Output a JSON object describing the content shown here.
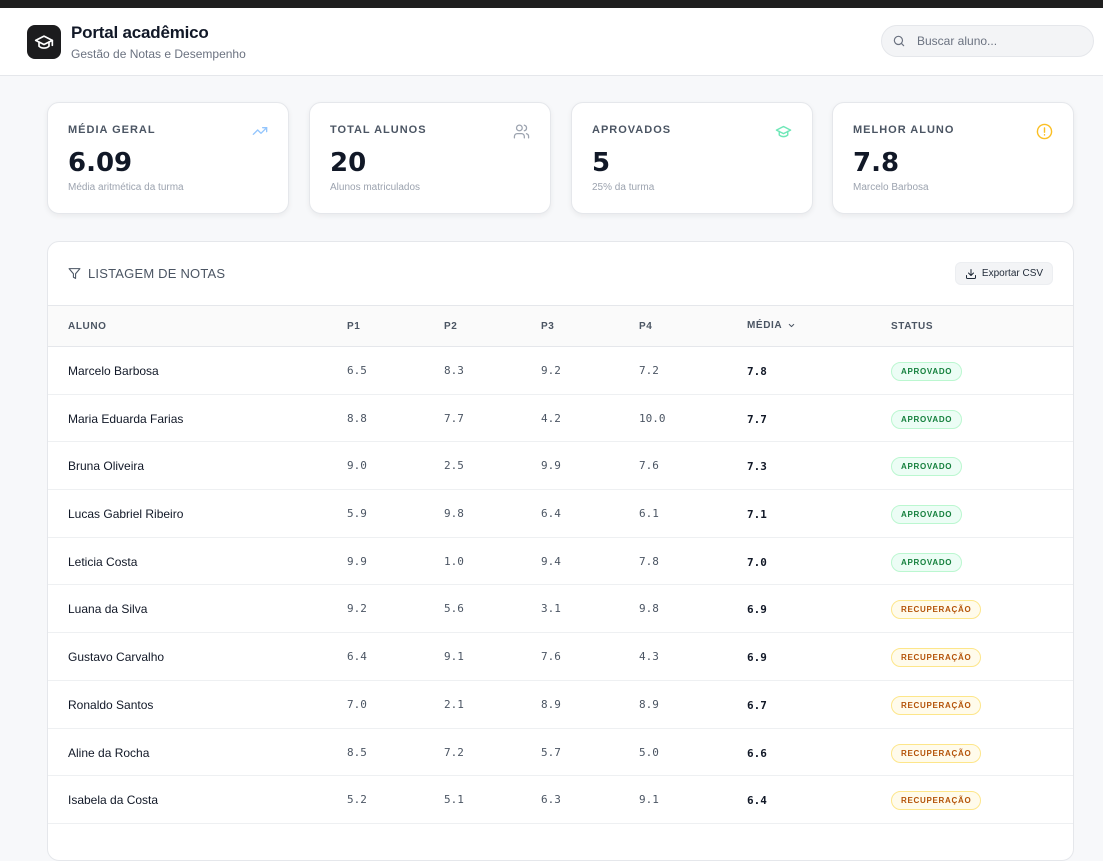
{
  "header": {
    "title": "Portal acadêmico",
    "subtitle": "Gestão de Notas e Desempenho",
    "search_placeholder": "Buscar aluno..."
  },
  "cards": [
    {
      "label": "MÉDIA GERAL",
      "value": "6.09",
      "desc": "Média aritmética da turma",
      "icon": "trending-up-icon",
      "icon_color": "#93c5fd"
    },
    {
      "label": "TOTAL ALUNOS",
      "value": "20",
      "desc": "Alunos matriculados",
      "icon": "users-icon",
      "icon_color": "#9ca3af"
    },
    {
      "label": "APROVADOS",
      "value": "5",
      "desc": "25% da turma",
      "icon": "graduation-cap-icon",
      "icon_color": "#6ee7b7"
    },
    {
      "label": "MELHOR ALUNO",
      "value": "7.8",
      "desc": "Marcelo Barbosa",
      "icon": "alert-circle-icon",
      "icon_color": "#fbbf24"
    }
  ],
  "panel": {
    "title": "LISTAGEM DE NOTAS",
    "export_label": "Exportar CSV"
  },
  "table": {
    "headers": [
      "ALUNO",
      "P1",
      "P2",
      "P3",
      "P4",
      "MÉDIA",
      "STATUS"
    ],
    "rows": [
      {
        "name": "Marcelo Barbosa",
        "p1": "6.5",
        "p2": "8.3",
        "p3": "9.2",
        "p4": "7.2",
        "avg": "7.8",
        "status": "APROVADO"
      },
      {
        "name": "Maria Eduarda Farias",
        "p1": "8.8",
        "p2": "7.7",
        "p3": "4.2",
        "p4": "10.0",
        "avg": "7.7",
        "status": "APROVADO"
      },
      {
        "name": "Bruna Oliveira",
        "p1": "9.0",
        "p2": "2.5",
        "p3": "9.9",
        "p4": "7.6",
        "avg": "7.3",
        "status": "APROVADO"
      },
      {
        "name": "Lucas Gabriel Ribeiro",
        "p1": "5.9",
        "p2": "9.8",
        "p3": "6.4",
        "p4": "6.1",
        "avg": "7.1",
        "status": "APROVADO"
      },
      {
        "name": "Leticia Costa",
        "p1": "9.9",
        "p2": "1.0",
        "p3": "9.4",
        "p4": "7.8",
        "avg": "7.0",
        "status": "APROVADO"
      },
      {
        "name": "Luana da Silva",
        "p1": "9.2",
        "p2": "5.6",
        "p3": "3.1",
        "p4": "9.8",
        "avg": "6.9",
        "status": "RECUPERAÇÃO"
      },
      {
        "name": "Gustavo Carvalho",
        "p1": "6.4",
        "p2": "9.1",
        "p3": "7.6",
        "p4": "4.3",
        "avg": "6.9",
        "status": "RECUPERAÇÃO"
      },
      {
        "name": "Ronaldo Santos",
        "p1": "7.0",
        "p2": "2.1",
        "p3": "8.9",
        "p4": "8.9",
        "avg": "6.7",
        "status": "RECUPERAÇÃO"
      },
      {
        "name": "Aline da Rocha",
        "p1": "8.5",
        "p2": "7.2",
        "p3": "5.7",
        "p4": "5.0",
        "avg": "6.6",
        "status": "RECUPERAÇÃO"
      },
      {
        "name": "Isabela da Costa",
        "p1": "5.2",
        "p2": "5.1",
        "p3": "6.3",
        "p4": "9.1",
        "avg": "6.4",
        "status": "RECUPERAÇÃO"
      }
    ]
  }
}
